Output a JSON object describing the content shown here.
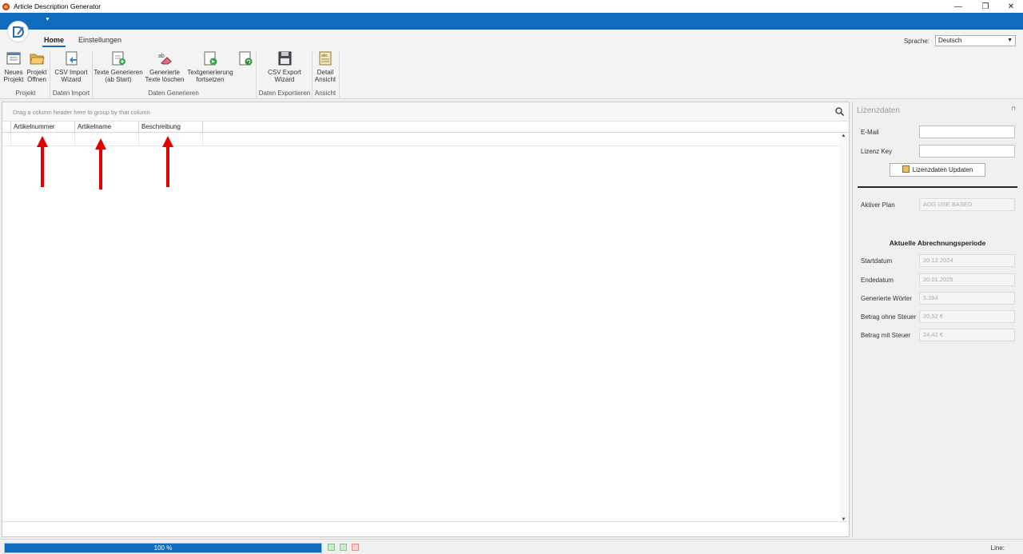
{
  "window": {
    "title": "Article Description Generator",
    "controls": [
      "—",
      "❐",
      "✕"
    ]
  },
  "ribbon": {
    "tabs": [
      {
        "label": "Home",
        "active": true
      },
      {
        "label": "Einstellungen",
        "active": false
      }
    ],
    "language_label": "Sprache:",
    "language_value": "Deutsch",
    "buttons": {
      "neues_projekt": [
        "Neues",
        "Projekt"
      ],
      "projekt_oeffnen": [
        "Projekt",
        "Öffnen"
      ],
      "csv_import": [
        "CSV Import",
        "Wizard"
      ],
      "texte_generieren": [
        "Texte Generieren",
        "(ab Start)"
      ],
      "texte_loeschen": [
        "Generierte",
        "Texte löschen"
      ],
      "textgenerierung_fortsetzen": [
        "Textgenerierung",
        "fortsetzen"
      ],
      "csv_export": [
        "CSV Export",
        "Wizard"
      ],
      "detail_ansicht": [
        "Detail",
        "Ansicht"
      ]
    },
    "groups": {
      "projekt": "Projekt",
      "daten_import": "Daten Import",
      "daten_generieren": "Daten Generieren",
      "daten_exportieren": "Daten Exportieren",
      "ansicht": "Ansicht"
    }
  },
  "grid": {
    "group_hint": "Drag a column header here to group by that column",
    "columns": [
      "Artikelnummer",
      "Artikelname",
      "Beschreibung"
    ]
  },
  "license_panel": {
    "title": "Lizenzdaten",
    "email_label": "E-Mail",
    "email_value": "",
    "key_label": "Lizenz Key",
    "key_value": "",
    "update_button": "Lizenzdaten Updaten",
    "plan_label": "Aktiver Plan",
    "plan_value": "ADG USE BASED",
    "period_heading": "Aktuelle Abrechnungsperiode",
    "fields": [
      {
        "label": "Startdatum",
        "value": "20.12.2024"
      },
      {
        "label": "Endedatum",
        "value": "20.01.2025"
      },
      {
        "label": "Generierte Wörter",
        "value": "5.284"
      },
      {
        "label": "Betrag ohne Steuer",
        "value": "20,52 €"
      },
      {
        "label": "Betrag mit Steuer",
        "value": "24,42 €"
      }
    ]
  },
  "status": {
    "progress_percent": 100,
    "progress_text": "100 %",
    "line_label": "Line:"
  },
  "colors": {
    "accent": "#0f6cbd",
    "arrow": "#e00000"
  }
}
